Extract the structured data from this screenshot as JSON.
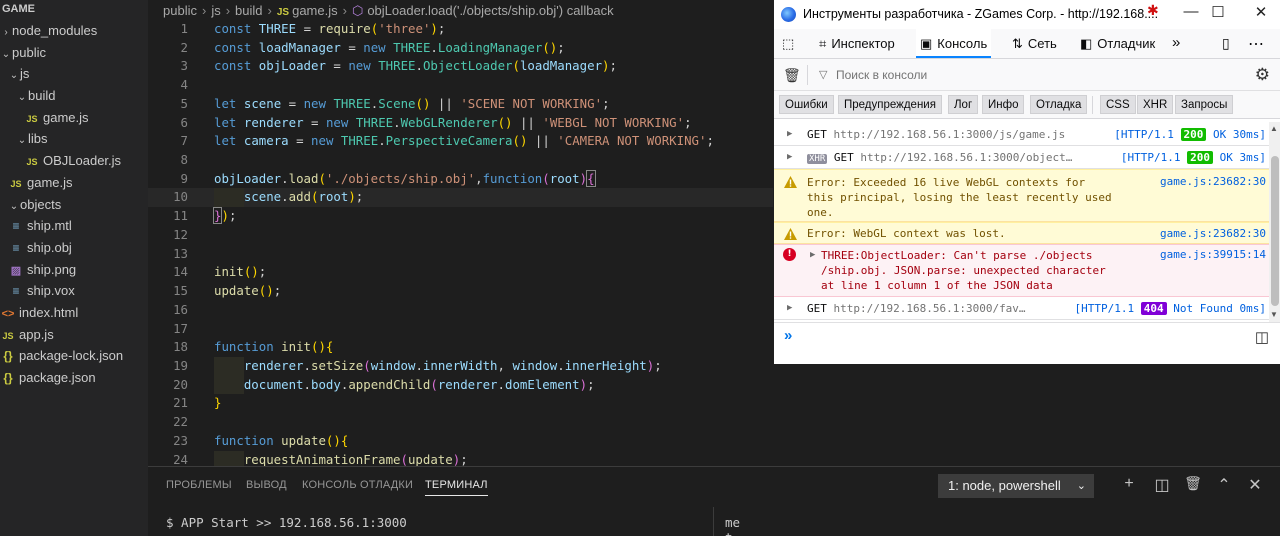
{
  "explorer": {
    "title": "GAME",
    "items": [
      {
        "name": "node_modules",
        "type": "folder",
        "chev": "›",
        "depth": 0
      },
      {
        "name": "public",
        "type": "folder",
        "chev": "⌄",
        "depth": 0
      },
      {
        "name": "js",
        "type": "folder",
        "chev": "⌄",
        "depth": 1
      },
      {
        "name": "build",
        "type": "folder",
        "chev": "⌄",
        "depth": 2
      },
      {
        "name": "game.js",
        "type": "js",
        "depth": 3
      },
      {
        "name": "libs",
        "type": "folder",
        "chev": "⌄",
        "depth": 2
      },
      {
        "name": "OBJLoader.js",
        "type": "js",
        "depth": 3
      },
      {
        "name": "game.js",
        "type": "js",
        "depth": 1
      },
      {
        "name": "objects",
        "type": "folder",
        "chev": "⌄",
        "depth": 1
      },
      {
        "name": "ship.mtl",
        "type": "file",
        "depth": 1
      },
      {
        "name": "ship.obj",
        "type": "file",
        "depth": 1
      },
      {
        "name": "ship.png",
        "type": "img",
        "depth": 1
      },
      {
        "name": "ship.vox",
        "type": "file",
        "depth": 1
      },
      {
        "name": "index.html",
        "type": "html",
        "depth": 0
      },
      {
        "name": "app.js",
        "type": "js",
        "depth": 0
      },
      {
        "name": "package-lock.json",
        "type": "json",
        "depth": 0
      },
      {
        "name": "package.json",
        "type": "json",
        "depth": 0
      }
    ]
  },
  "breadcrumb": {
    "items": [
      "public",
      "js",
      "build",
      "game.js",
      "objLoader.load('./objects/ship.obj') callback"
    ],
    "js_badge": "JS"
  },
  "code": {
    "line_numbers": [
      "1",
      "2",
      "3",
      "4",
      "5",
      "6",
      "7",
      "8",
      "9",
      "10",
      "11",
      "12",
      "13",
      "14",
      "15",
      "16",
      "17",
      "18",
      "19",
      "20",
      "21",
      "22",
      "23",
      "24"
    ]
  },
  "panel": {
    "tabs": [
      "ПРОБЛЕМЫ",
      "ВЫВОД",
      "КОНСОЛЬ ОТЛАДКИ",
      "ТЕРМИНАЛ"
    ],
    "active_tab": "ТЕРМИНАЛ",
    "terminal_select": "1: node, powershell",
    "terminal_left": "$ APP Start >> 192.168.56.1:3000",
    "terminal_right": "me\nt ...",
    "icons": [
      "plus-icon",
      "split-icon",
      "trash-icon",
      "chevron-up-icon",
      "close-icon"
    ]
  },
  "devtools": {
    "window_title": "Инструменты разработчика - ZGames Corp. - http://192.168....",
    "toolbar": {
      "inspector": "Инспектор",
      "console": "Консоль",
      "network": "Сеть",
      "debugger": "Отладчик"
    },
    "filter_placeholder": "Поиск в консоли",
    "categories": [
      "Ошибки",
      "Предупреждения",
      "Лог",
      "Инфо",
      "Отладка",
      "CSS",
      "XHR",
      "Запросы"
    ],
    "messages": [
      {
        "kind": "net",
        "method": "GET",
        "url": "http://192.168.56.1:3000/js/game.js",
        "proto": "[HTTP/1.1",
        "status": "200",
        "status_text": "OK 30ms]"
      },
      {
        "kind": "xhr",
        "badge": "XHR",
        "method": "GET",
        "url": "http://192.168.56.1:3000/object…",
        "proto": "[HTTP/1.1",
        "status": "200",
        "status_text": "OK 3ms]"
      },
      {
        "kind": "warn",
        "lines": [
          "Error: Exceeded 16 live WebGL contexts for",
          "this principal, losing the least recently used",
          "one."
        ],
        "source": "game.js:23682:30"
      },
      {
        "kind": "warn",
        "lines": [
          "Error: WebGL context was lost."
        ],
        "source": "game.js:23682:30"
      },
      {
        "kind": "error",
        "lines": [
          "THREE:ObjectLoader: Can't parse ./objects",
          "/ship.obj. JSON.parse: unexpected character",
          "at line 1 column 1 of the JSON data"
        ],
        "source": "game.js:39915:14"
      },
      {
        "kind": "net",
        "method": "GET",
        "url": "http://192.168.56.1:3000/fav…",
        "proto": "[HTTP/1.1",
        "status": "404",
        "status_text": "Not Found 0ms]"
      }
    ],
    "prompt": "»"
  },
  "colors": {
    "editor_bg": "#1e1e1e",
    "sidebar_bg": "#252526",
    "devtools_accent": "#0a84ff",
    "status_200": "#12bc00",
    "status_404": "#8000d7",
    "warning_bg": "#fffbd6",
    "error_bg": "#fdf2f5"
  }
}
